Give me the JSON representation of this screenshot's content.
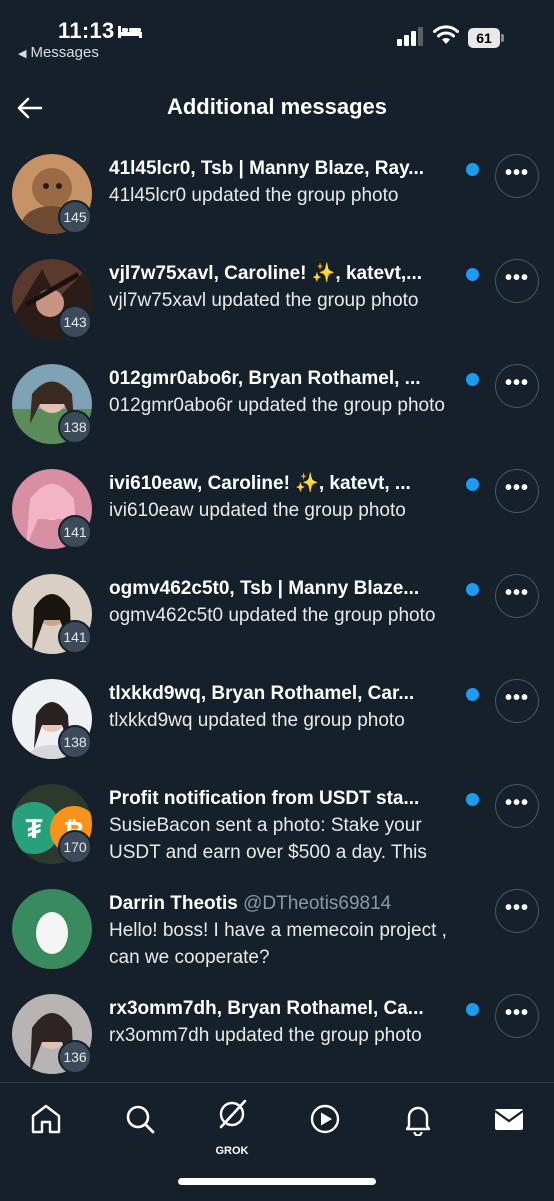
{
  "status_bar": {
    "time": "11:13",
    "back_app": "Messages",
    "battery": "61"
  },
  "header": {
    "title": "Additional messages",
    "back_icon": "arrow-left-icon"
  },
  "colors": {
    "background": "#15202b",
    "unread_dot": "#1d9bf0",
    "count_badge": "#3d4a5a"
  },
  "conversations": [
    {
      "name": "41l45lcr0, Tsb | Manny Blaze, Ray...",
      "message": "41l45lcr0 updated the group photo",
      "count": "145",
      "unread": true
    },
    {
      "name": "vjl7w75xavl, Caroline! ✨, katevt,...",
      "message": "vjl7w75xavl updated the group photo",
      "count": "143",
      "unread": true
    },
    {
      "name": "012gmr0abo6r, Bryan Rothamel, ...",
      "message": "012gmr0abo6r updated the group photo",
      "count": "138",
      "unread": true
    },
    {
      "name": "ivi610eaw, Caroline! ✨, katevt, ...",
      "message": "ivi610eaw updated the group photo",
      "count": "141",
      "unread": true
    },
    {
      "name": "ogmv462c5t0, Tsb | Manny Blaze...",
      "message": "ogmv462c5t0 updated the group photo",
      "count": "141",
      "unread": true
    },
    {
      "name": "tlxkkd9wq, Bryan Rothamel, Car...",
      "message": "tlxkkd9wq updated the group photo",
      "count": "138",
      "unread": true
    },
    {
      "name": "Profit notification from USDT sta...",
      "message": "SusieBacon sent a photo: Stake your USDT and earn over $500 a day. This",
      "count": "170",
      "unread": true
    },
    {
      "name": "Darrin Theotis",
      "handle": "@DTheotis69814",
      "message": "Hello! boss! I have a memecoin project , can we cooperate?",
      "count": "",
      "unread": false
    },
    {
      "name": "rx3omm7dh, Bryan Rothamel, Ca...",
      "message": "rx3omm7dh updated the group photo",
      "count": "136",
      "unread": true
    }
  ],
  "bottom_nav": {
    "items": [
      "home-icon",
      "search-icon",
      "grok-icon",
      "play-icon",
      "bell-icon",
      "mail-icon"
    ],
    "grok_label": "GROK"
  }
}
